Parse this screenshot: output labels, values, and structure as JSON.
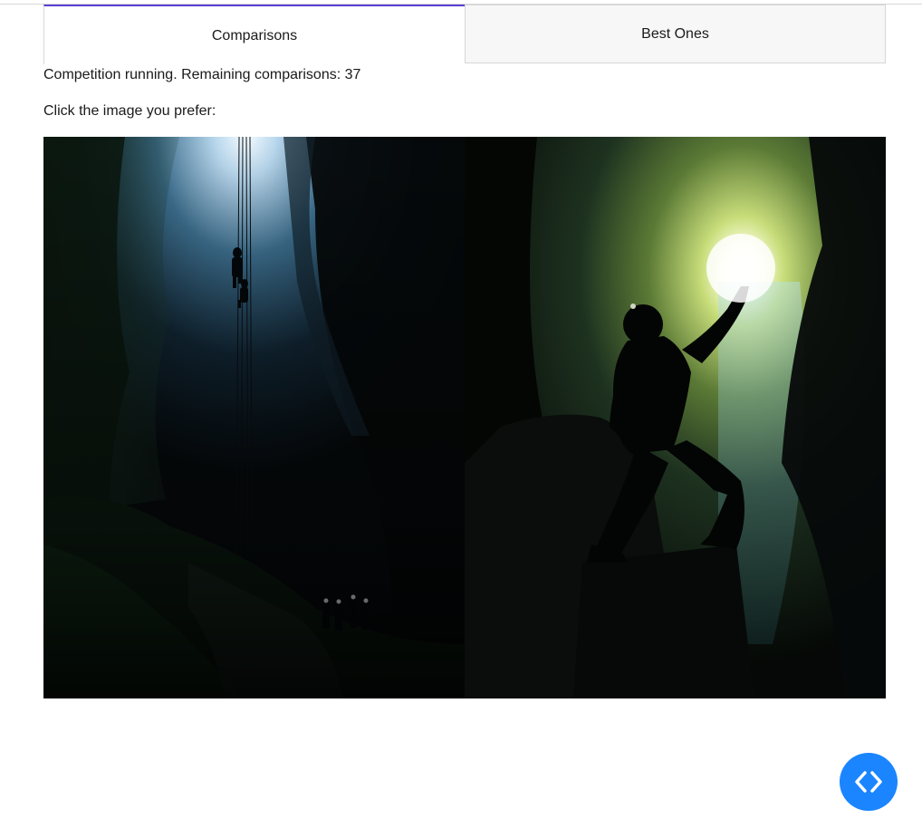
{
  "tabs": [
    {
      "label": "Comparisons",
      "active": true
    },
    {
      "label": "Best Ones",
      "active": false
    }
  ],
  "status_text": "Competition running. Remaining comparisons: 37",
  "prompt_text": "Click the image you prefer:",
  "images": [
    {
      "icon": "cave-rappel-photo"
    },
    {
      "icon": "cave-explorer-silhouette-photo"
    }
  ],
  "fab": {
    "icon": "code-chevrons-icon",
    "color": "#1a85ff"
  },
  "colors": {
    "active_tab_accent": "#5b3fd4"
  }
}
